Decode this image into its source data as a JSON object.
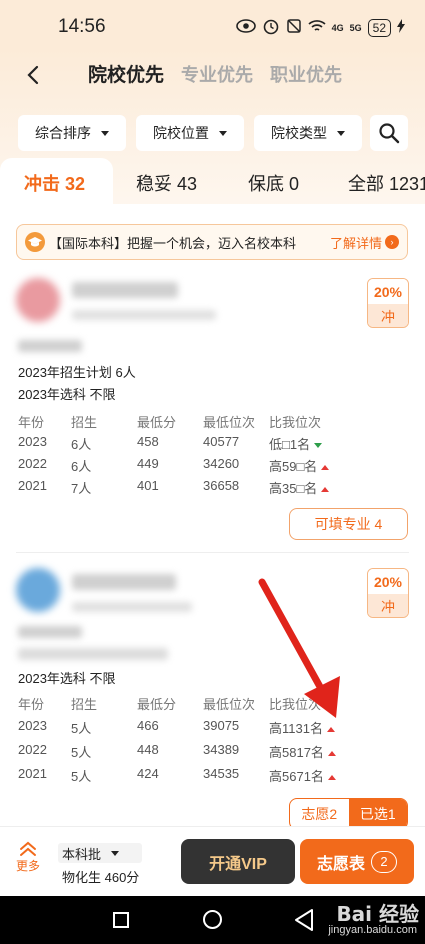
{
  "status_bar": {
    "time": "14:56",
    "battery": "52",
    "signal_1": "4G",
    "signal_2": "5G"
  },
  "header": {
    "tabs": [
      {
        "label": "院校优先"
      },
      {
        "label": "专业优先"
      },
      {
        "label": "职业优先"
      }
    ]
  },
  "filters": [
    {
      "label": "综合排序"
    },
    {
      "label": "院校位置"
    },
    {
      "label": "院校类型"
    }
  ],
  "risk_tabs": [
    {
      "label": "冲击 32"
    },
    {
      "label": "稳妥 43"
    },
    {
      "label": "保底 0"
    },
    {
      "label": "全部 1231"
    }
  ],
  "banner": {
    "text": "【国际本科】把握一个机会，迈入名校本科",
    "link": "了解详情"
  },
  "table_headers": [
    "年份",
    "招生",
    "最低分",
    "最低位次",
    "比我位次"
  ],
  "cards": [
    {
      "rate": "20%",
      "level": "冲",
      "plan": "2023年招生计划 6人",
      "subjects": "2023年选科 不限",
      "rows": [
        {
          "year": "2023",
          "enroll": "6人",
          "min_score": "458",
          "min_rank": "40577",
          "compare": "低□1名",
          "trend": "down"
        },
        {
          "year": "2022",
          "enroll": "6人",
          "min_score": "449",
          "min_rank": "34260",
          "compare": "高59□名",
          "trend": "up"
        },
        {
          "year": "2021",
          "enroll": "7人",
          "min_score": "401",
          "min_rank": "36658",
          "compare": "高35□名",
          "trend": "up"
        }
      ],
      "majors_button": "可填专业 4"
    },
    {
      "rate": "20%",
      "level": "冲",
      "subjects": "2023年选科 不限",
      "rows": [
        {
          "year": "2023",
          "enroll": "5人",
          "min_score": "466",
          "min_rank": "39075",
          "compare": "高1131名",
          "trend": "up"
        },
        {
          "year": "2022",
          "enroll": "5人",
          "min_score": "448",
          "min_rank": "34389",
          "compare": "高5817名",
          "trend": "up"
        },
        {
          "year": "2021",
          "enroll": "5人",
          "min_score": "424",
          "min_rank": "34535",
          "compare": "高5671名",
          "trend": "up"
        }
      ],
      "wish_label": "志愿2",
      "selected_label": "已选1"
    }
  ],
  "bottom_bar": {
    "more": "更多",
    "batch": "本科批",
    "score": "物化生 460分",
    "vip": "开通VIP",
    "wish_table": "志愿表",
    "wish_count": "2"
  },
  "watermark": {
    "brand": "Bai 经验",
    "url": "jingyan.baidu.com"
  },
  "colors": {
    "accent": "#f26a1b",
    "up": "#e53935",
    "down": "#2e9e4a",
    "annotation": "#e0241b"
  }
}
